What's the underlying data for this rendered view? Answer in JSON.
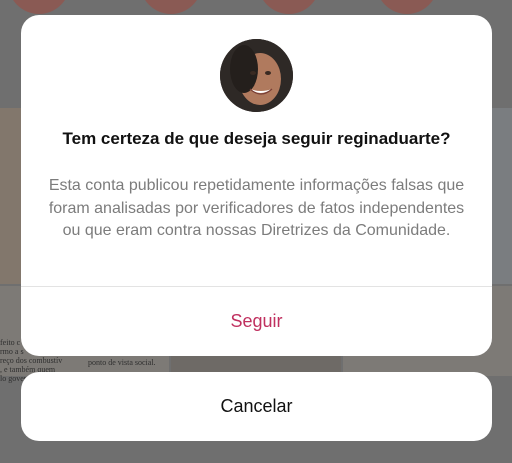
{
  "dialog": {
    "title": "Tem certeza de que deseja seguir reginaduarte?",
    "message": "Esta conta publicou repetidamente informações falsas que foram analisadas por verificadores de fatos independentes ou que eram contra nossas Diretrizes da Comunidade.",
    "follow_label": "Seguir",
    "cancel_label": "Cancelar"
  },
  "background": {
    "left_snippet": "feito c\nrmo a s\nreço dos combustív\n, e também quem\nlo governo",
    "mid_snippet": "ponto de vista social."
  },
  "colors": {
    "follow_accent": "#c0305f",
    "overlay": "#6f6f6f"
  }
}
